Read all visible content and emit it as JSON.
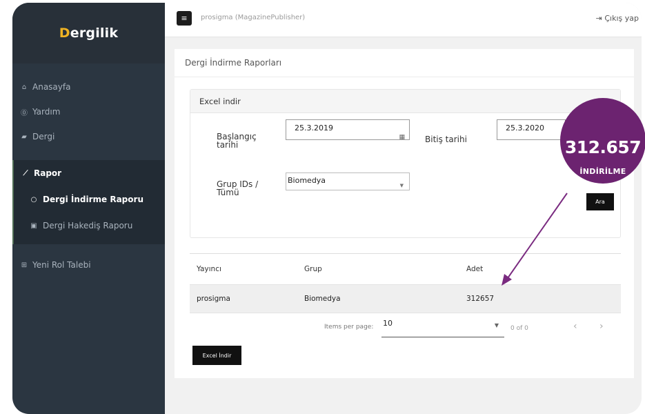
{
  "sidebar": {
    "logo": "Dergilik",
    "items": [
      {
        "label": "Anasayfa",
        "icon": "home-icon"
      },
      {
        "label": "Yardım",
        "icon": "help-icon"
      },
      {
        "label": "Dergi",
        "icon": "book-icon"
      }
    ],
    "rapor": {
      "label": "Rapor",
      "icon": "chart-line-icon",
      "sub_items": [
        {
          "label": "Dergi İndirme Raporu",
          "icon": "circle-icon",
          "active": true
        },
        {
          "label": "Dergi Hakediş Raporu",
          "icon": "money-icon",
          "active": false
        }
      ]
    },
    "yeni_rol": {
      "label": "Yeni Rol Talebi",
      "icon": "plus-square-icon"
    }
  },
  "header": {
    "user": "prosigma (MagazinePublisher)",
    "logout": "Çıkış yap"
  },
  "page": {
    "title": "Dergi İndirme Raporları"
  },
  "filter": {
    "header": "Excel indir",
    "start_label": "Başlangıç tarihi",
    "start_value": "25.3.2019",
    "end_label": "Bitiş tarihi",
    "end_value": "25.3.2020",
    "group_label": "Grup IDs / Tümü",
    "group_value": "Biomedya",
    "search_button": "Ara"
  },
  "table": {
    "columns": [
      "Yayıncı",
      "Grup",
      "Adet"
    ],
    "rows": [
      {
        "yayinci": "prosigma",
        "grup": "Biomedya",
        "adet": "312657"
      }
    ]
  },
  "paginator": {
    "items_per_page_label": "Items per page:",
    "items_per_page_value": "10",
    "range": "0 of 0"
  },
  "excel_button": "Excel İndir",
  "callout": {
    "number": "312.657",
    "caption": "İNDİRİLME",
    "color": "#6c2370"
  }
}
